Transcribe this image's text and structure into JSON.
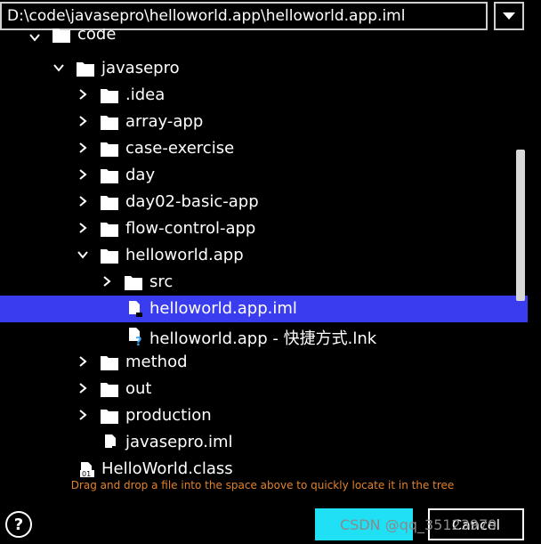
{
  "path_bar": {
    "value": "D:\\code\\javasepro\\helloworld.app\\helloworld.app.iml"
  },
  "tree": {
    "code": "code",
    "javasepro": "javasepro",
    "idea": ".idea",
    "array_app": "array-app",
    "case_exercise": "case-exercise",
    "day": "day",
    "day02": "day02-basic-app",
    "flow_control": "flow-control-app",
    "helloworld_app": "helloworld.app",
    "src": "src",
    "iml_file": "helloworld.app.iml",
    "lnk_file": "helloworld.app - 快捷方式.lnk",
    "method": "method",
    "out": "out",
    "production": "production",
    "javasepro_iml": "javasepro.iml",
    "helloworld_class": "HelloWorld.class"
  },
  "hint": "Drag and drop a file into the space above to quickly locate it in the tree",
  "help_label": "?",
  "ok_label": "",
  "cancel_label": "Cancel",
  "watermark": "CSDN @qq_35123979",
  "colors": {
    "selection": "#3a3cf0",
    "hint": "#e0822b",
    "ok_button": "#1fe0f5"
  }
}
